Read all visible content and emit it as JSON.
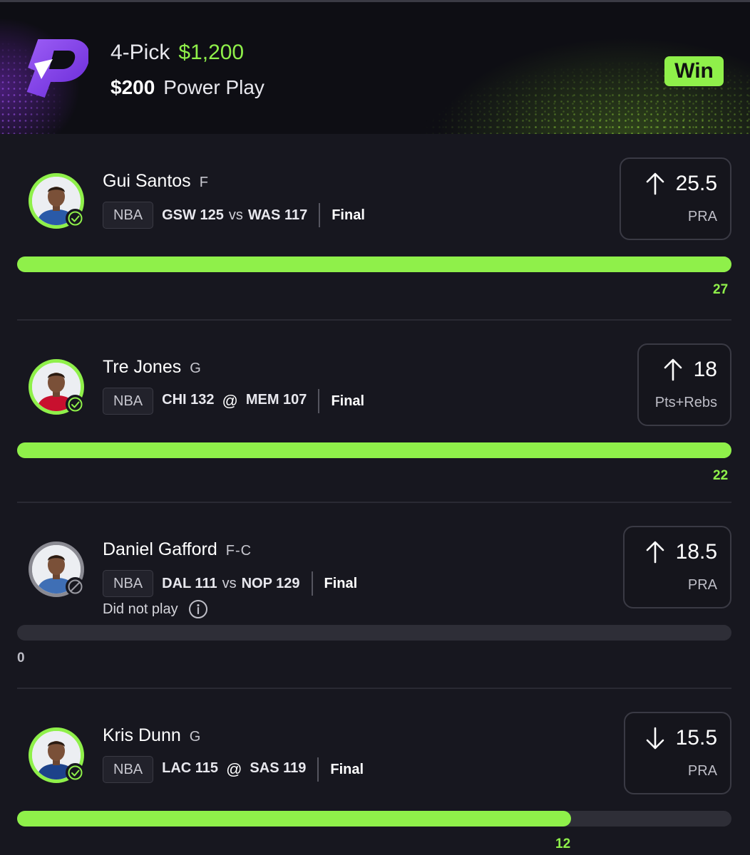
{
  "header": {
    "pick_count": "4-Pick",
    "payout": "$1,200",
    "stake": "$200",
    "play_type": "Power Play",
    "result_badge": "Win",
    "accent_color": "#8ff04a",
    "brand_color": "#7b3fe4"
  },
  "picks": [
    {
      "name": "Gui Santos",
      "position": "F",
      "league": "NBA",
      "team1": "GSW 125",
      "connector": "vs",
      "team2": "WAS 117",
      "status": "Final",
      "direction": "up",
      "line": "25.5",
      "stat": "PRA",
      "actual": "27",
      "progress": 1.0,
      "result": "hit",
      "jersey_color": "#2a5aa8"
    },
    {
      "name": "Tre Jones",
      "position": "G",
      "league": "NBA",
      "team1": "CHI 132",
      "connector": "@",
      "team2": "MEM 107",
      "status": "Final",
      "direction": "up",
      "line": "18",
      "stat": "Pts+Rebs",
      "actual": "22",
      "progress": 1.0,
      "result": "hit",
      "jersey_color": "#c8102e"
    },
    {
      "name": "Daniel Gafford",
      "position": "F-C",
      "league": "NBA",
      "team1": "DAL 111",
      "connector": "vs",
      "team2": "NOP 129",
      "status": "Final",
      "note": "Did not play",
      "direction": "up",
      "line": "18.5",
      "stat": "PRA",
      "actual": "0",
      "progress": 0,
      "result": "dnp",
      "jersey_color": "#3f6fb5"
    },
    {
      "name": "Kris Dunn",
      "position": "G",
      "league": "NBA",
      "team1": "LAC 115",
      "connector": "@",
      "team2": "SAS 119",
      "status": "Final",
      "direction": "down",
      "line": "15.5",
      "stat": "PRA",
      "actual": "12",
      "progress": 0.775,
      "result": "hit",
      "jersey_color": "#1d428a"
    }
  ]
}
